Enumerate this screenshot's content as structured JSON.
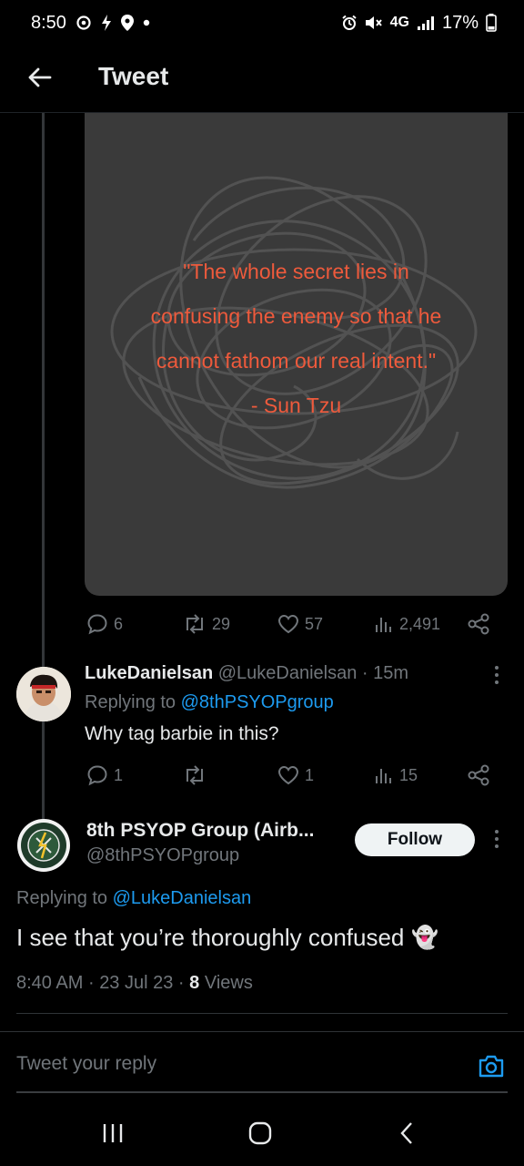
{
  "status_bar": {
    "time": "8:50",
    "network": "4G",
    "battery": "17%"
  },
  "header": {
    "title": "Tweet"
  },
  "quoted_media": {
    "quote_line1": "\"The whole secret lies in",
    "quote_line2": "confusing the enemy so that he",
    "quote_line3": "cannot fathom our real intent.\"",
    "quote_author": "- Sun Tzu",
    "quote_color": "#ee5a3c"
  },
  "parent_actions": {
    "replies": "6",
    "retweets": "29",
    "likes": "57",
    "views": "2,491"
  },
  "reply_tweet": {
    "name": "LukeDanielsan",
    "handle": "@LukeDanielsan",
    "time": "15m",
    "replying_label": "Replying to",
    "replying_to": "@8thPSYOPgroup",
    "text": "Why tag barbie in this?",
    "actions": {
      "replies": "1",
      "retweets": "",
      "likes": "1",
      "views": "15"
    }
  },
  "main_tweet": {
    "name": "8th PSYOP Group (Airb...",
    "handle": "@8thPSYOPgroup",
    "follow_label": "Follow",
    "replying_label": "Replying to",
    "replying_to": "@LukeDanielsan",
    "text": "I see that you’re thoroughly confused",
    "emoji": "👻",
    "timestamp": "8:40 AM",
    "date": "23 Jul 23",
    "views_count": "8",
    "views_label": "Views"
  },
  "reply_bar": {
    "placeholder": "Tweet your reply"
  },
  "colors": {
    "background": "#000000",
    "accent": "#1d9bf0",
    "muted": "#71767b"
  }
}
